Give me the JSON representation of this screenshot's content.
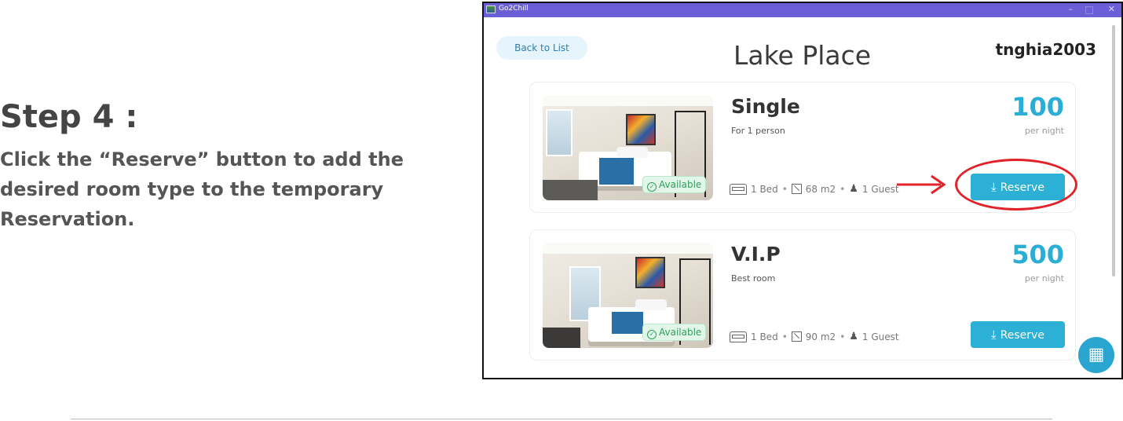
{
  "instruction": {
    "step_title": "Step 4 :",
    "step_text": "Click the “Reserve” button to add the desired room type to the temporary Reservation."
  },
  "window": {
    "app_name": "Go2Chill",
    "controls": {
      "minimize": "–",
      "close": "✕"
    }
  },
  "header": {
    "back_label": "Back to List",
    "place_title": "Lake Place",
    "username": "tnghia2003"
  },
  "rooms": [
    {
      "name": "Single",
      "description": "For 1 person",
      "price": "100",
      "price_unit": "per night",
      "badge": "Available",
      "beds": "1 Bed",
      "area": "68 m2",
      "guests": "1 Guest",
      "reserve_label": "Reserve"
    },
    {
      "name": "V.I.P",
      "description": "Best room",
      "price": "500",
      "price_unit": "per night",
      "badge": "Available",
      "beds": "1 Bed",
      "area": "90 m2",
      "guests": "1 Guest",
      "reserve_label": "Reserve"
    }
  ],
  "icons": {
    "bullet": "•",
    "person": "♟",
    "download": "⤓",
    "check": "✓",
    "calendar": "▦"
  },
  "colors": {
    "titlebar": "#6a5fd6",
    "accent": "#2db0d5",
    "price": "#2aaed6",
    "available": "#2ea05a",
    "annotation": "#e12329"
  }
}
